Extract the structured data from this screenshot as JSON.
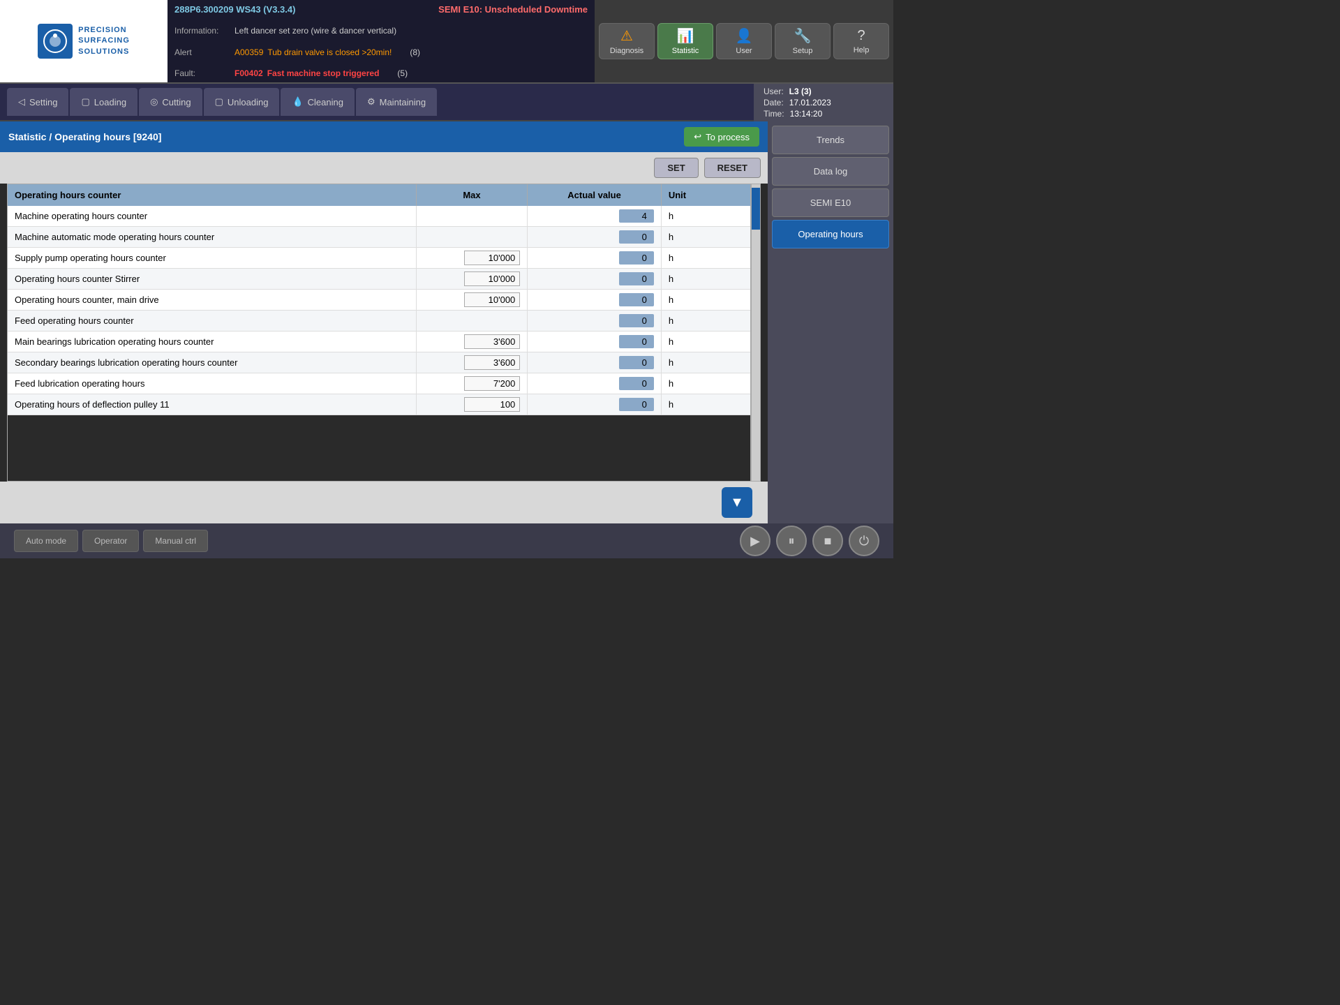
{
  "header": {
    "version_info": "288P6.300209 WS43 (V3.3.4)",
    "semi_status": "SEMI E10: Unscheduled Downtime",
    "info_label": "Information:",
    "info_text": "Left dancer set zero (wire & dancer vertical)",
    "alert_label": "Alert",
    "alert_code": "A00359",
    "alert_text": "Tub drain valve is closed >20min!",
    "alert_count": "(8)",
    "fault_label": "Fault:",
    "fault_code": "F00402",
    "fault_text": "Fast machine stop triggered",
    "fault_count": "(5)"
  },
  "logo": {
    "line1": "PRECISION",
    "line2": "SURFACING",
    "line3": "SOLUTIONS"
  },
  "nav_buttons": [
    {
      "id": "diagnosis",
      "label": "Diagnosis",
      "icon": "⚠",
      "active": false,
      "warning": true
    },
    {
      "id": "statistic",
      "label": "Statistic",
      "icon": "📊",
      "active": true,
      "warning": false
    },
    {
      "id": "user",
      "label": "User",
      "icon": "👤",
      "active": false,
      "warning": false
    },
    {
      "id": "setup",
      "label": "Setup",
      "icon": "🔧",
      "active": false,
      "warning": false
    },
    {
      "id": "help",
      "label": "Help",
      "icon": "?",
      "active": false,
      "warning": false
    }
  ],
  "workflow_tabs": [
    {
      "id": "setting",
      "label": "Setting",
      "icon": "◁",
      "active": false
    },
    {
      "id": "loading",
      "label": "Loading",
      "icon": "▢",
      "active": false
    },
    {
      "id": "cutting",
      "label": "Cutting",
      "icon": "◎",
      "active": false
    },
    {
      "id": "unloading",
      "label": "Unloading",
      "icon": "▢",
      "active": false
    },
    {
      "id": "cleaning",
      "label": "Cleaning",
      "icon": "💧",
      "active": false
    },
    {
      "id": "maintaining",
      "label": "Maintaining",
      "icon": "⚙",
      "active": false
    }
  ],
  "user_info": {
    "user_label": "User:",
    "user_value": "L3 (3)",
    "date_label": "Date:",
    "date_value": "17.01.2023",
    "time_label": "Time:",
    "time_value": "13:14:20"
  },
  "breadcrumb": "Statistic / Operating hours [9240]",
  "to_process_label": "To process",
  "controls": {
    "set_label": "SET",
    "reset_label": "RESET"
  },
  "table": {
    "columns": [
      "Operating hours counter",
      "Max",
      "Actual value",
      "Unit"
    ],
    "rows": [
      {
        "name": "Machine operating hours counter",
        "max": "",
        "actual": "4",
        "unit": "h"
      },
      {
        "name": "Machine automatic mode operating hours counter",
        "max": "",
        "actual": "0",
        "unit": "h"
      },
      {
        "name": "Supply pump operating hours counter",
        "max": "10'000",
        "actual": "0",
        "unit": "h"
      },
      {
        "name": "Operating hours counter Stirrer",
        "max": "10'000",
        "actual": "0",
        "unit": "h"
      },
      {
        "name": "Operating hours counter, main drive",
        "max": "10'000",
        "actual": "0",
        "unit": "h"
      },
      {
        "name": "Feed operating hours counter",
        "max": "",
        "actual": "0",
        "unit": "h"
      },
      {
        "name": "Main bearings lubrication operating hours counter",
        "max": "3'600",
        "actual": "0",
        "unit": "h"
      },
      {
        "name": "Secondary bearings lubrication operating hours counter",
        "max": "3'600",
        "actual": "0",
        "unit": "h"
      },
      {
        "name": "Feed lubrication operating hours",
        "max": "7'200",
        "actual": "0",
        "unit": "h"
      },
      {
        "name": "Operating hours of deflection pulley 11",
        "max": "100",
        "actual": "0",
        "unit": "h"
      }
    ]
  },
  "sidebar_buttons": [
    {
      "id": "trends",
      "label": "Trends",
      "active": false
    },
    {
      "id": "data-log",
      "label": "Data log",
      "active": false
    },
    {
      "id": "semi-e10",
      "label": "SEMI E10",
      "active": false
    },
    {
      "id": "operating-hours",
      "label": "Operating hours",
      "active": true
    }
  ],
  "bottom_buttons": {
    "left": [
      {
        "id": "auto-mode",
        "label": "Auto mode"
      },
      {
        "id": "operator",
        "label": "Operator"
      },
      {
        "id": "manual-ctrl",
        "label": "Manual ctrl"
      }
    ],
    "right": [
      {
        "id": "play",
        "icon": "▶"
      },
      {
        "id": "pause",
        "icon": "⏸"
      },
      {
        "id": "stop",
        "icon": "■"
      },
      {
        "id": "power",
        "icon": "⏻"
      }
    ]
  },
  "down_arrow": "▼"
}
